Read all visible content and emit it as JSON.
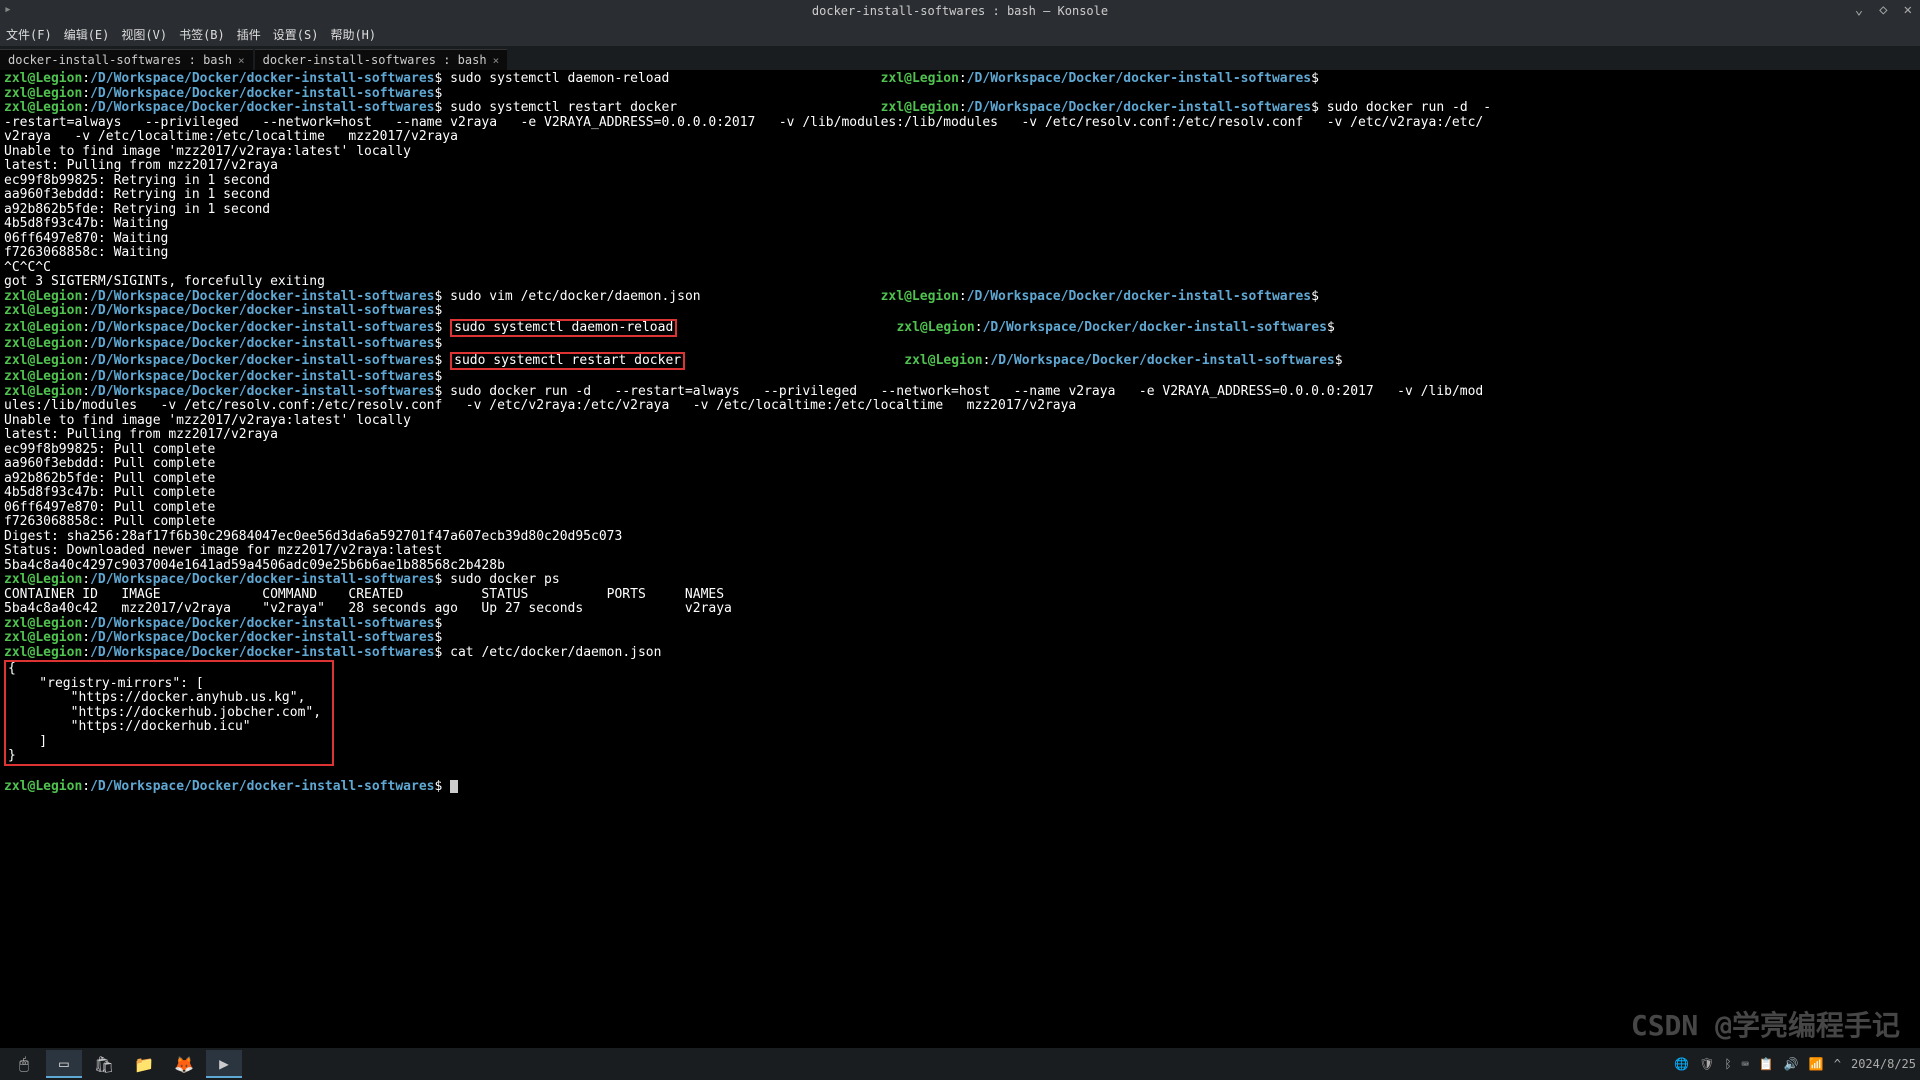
{
  "window": {
    "title": "docker-install-softwares : bash — Konsole",
    "minimize_icon": "⌄",
    "maximize_icon": "◇",
    "close_icon": "✕",
    "app_icon": "▸"
  },
  "menubar": {
    "file": "文件(F)",
    "edit": "编辑(E)",
    "view": "视图(V)",
    "bookmarks": "书签(B)",
    "plugins": "插件",
    "settings": "设置(S)",
    "help": "帮助(H)"
  },
  "tabs": [
    {
      "label": "docker-install-softwares : bash",
      "close": "×"
    },
    {
      "label": "docker-install-softwares : bash",
      "close": "×"
    }
  ],
  "prompt": {
    "user": "zxl",
    "at": "@",
    "host": "Legion",
    "colon": ":",
    "path": "/D/Workspace/Docker/docker-install-softwares",
    "dollar": "$"
  },
  "lines": {
    "c1": " sudo systemctl daemon-reload",
    "c2": " sudo systemctl restart docker",
    "c3": " sudo docker run -d  --restart=always   --privileged   --network=host   --name v2raya   -e V2RAYA_ADDRESS=0.0.0.0:2017   -v /lib/modules:/lib/modules   -v /etc/resolv.conf:/etc/resolv.conf   -v /etc/v2raya:/etc/v2raya   -v /etc/localtime:/etc/localtime   mzz2017/v2raya",
    "o1": "Unable to find image 'mzz2017/v2raya:latest' locally",
    "o2": "latest: Pulling from mzz2017/v2raya",
    "o3": "ec99f8b99825: Retrying in 1 second",
    "o4": "aa960f3ebddd: Retrying in 1 second",
    "o5": "a92b862b5fde: Retrying in 1 second",
    "o6": "4b5d8f93c47b: Waiting",
    "o7": "06ff6497e870: Waiting",
    "o8": "f7263068858c: Waiting",
    "o9": "^C^C^C",
    "o10": "got 3 SIGTERM/SIGINTs, forcefully exiting",
    "c4": " sudo vim /etc/docker/daemon.json",
    "c5": "sudo systemctl daemon-reload",
    "c6": "sudo systemctl restart docker",
    "c7": " sudo docker run -d   --restart=always   --privileged   --network=host   --name v2raya   -e V2RAYA_ADDRESS=0.0.0.0:2017   -v /lib/modules:/lib/modules   -v /etc/resolv.conf:/etc/resolv.conf   -v /etc/v2raya:/etc/v2raya   -v /etc/localtime:/etc/localtime   mzz2017/v2raya",
    "p1": "Unable to find image 'mzz2017/v2raya:latest' locally",
    "p2": "latest: Pulling from mzz2017/v2raya",
    "p3": "ec99f8b99825: Pull complete",
    "p4": "aa960f3ebddd: Pull complete",
    "p5": "a92b862b5fde: Pull complete",
    "p6": "4b5d8f93c47b: Pull complete",
    "p7": "06ff6497e870: Pull complete",
    "p8": "f7263068858c: Pull complete",
    "p9": "Digest: sha256:28af17f6b30c29684047ec0ee56d3da6a592701f47a607ecb39d80c20d95c073",
    "p10": "Status: Downloaded newer image for mzz2017/v2raya:latest",
    "p11": "5ba4c8a40c4297c9037004e1641ad59a4506adc09e25b6b6ae1b88568c2b428b",
    "c8": " sudo docker ps",
    "h1": "CONTAINER ID   IMAGE             COMMAND    CREATED          STATUS          PORTS     NAMES",
    "r1": "5ba4c8a40c42   mzz2017/v2raya    \"v2raya\"   28 seconds ago   Up 27 seconds             v2raya",
    "c9": " cat /etc/docker/daemon.json",
    "j1": "{",
    "j2": "    \"registry-mirrors\": [",
    "j3": "        \"https://docker.anyhub.us.kg\",",
    "j4": "        \"https://dockerhub.jobcher.com\",",
    "j5": "        \"https://dockerhub.icu\"",
    "j6": "    ]",
    "j7": "}"
  },
  "taskbar": {
    "date": "2024/8/25"
  },
  "watermark": "CSDN @学亮编程手记"
}
